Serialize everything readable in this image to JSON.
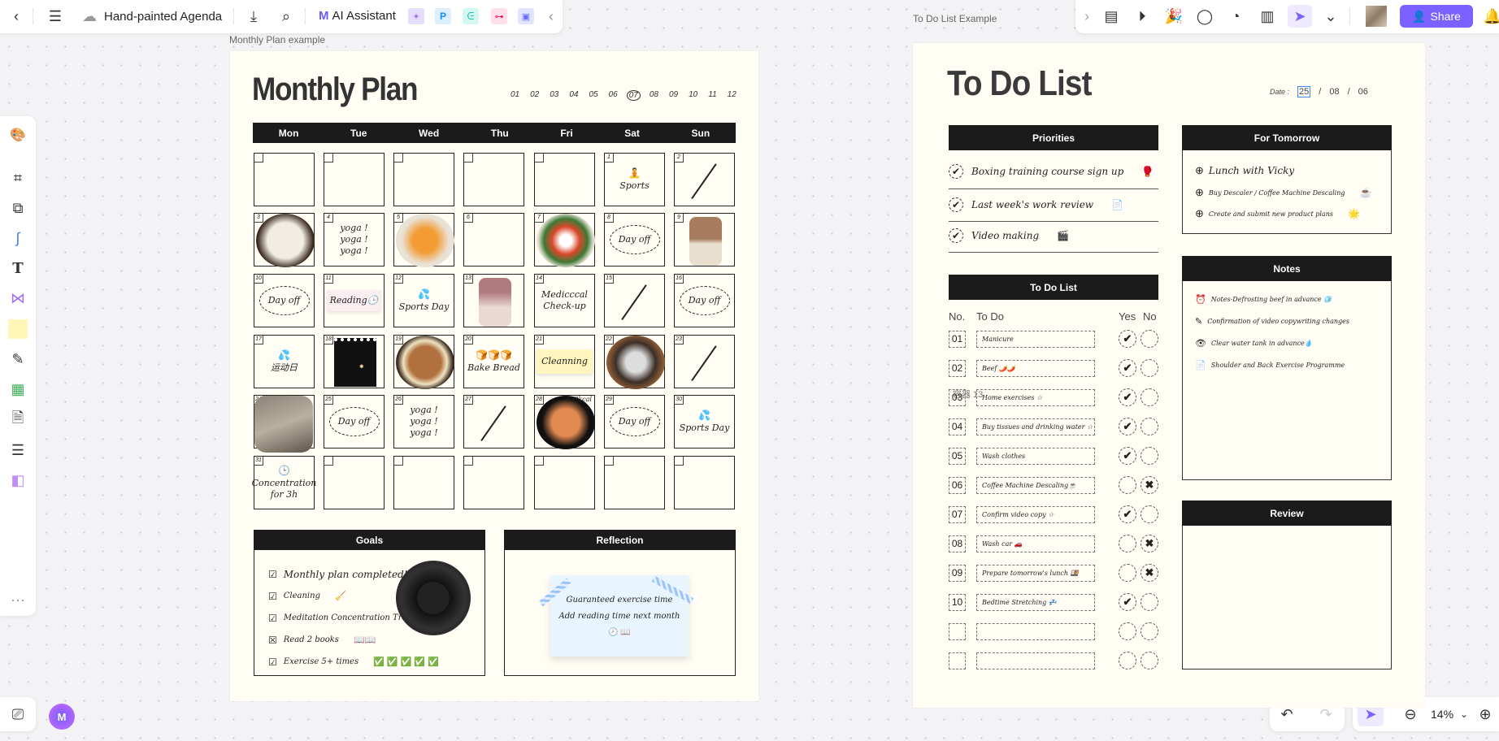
{
  "toolbar": {
    "title": "Hand-painted Agenda",
    "ai_label": "AI Assistant",
    "share_label": "Share",
    "zoom": "14%",
    "accent": "#7b61ff"
  },
  "frames": {
    "monthly_label": "Monthly Plan example",
    "todo_label": "To Do List Example",
    "container_label": "容器 13"
  },
  "monthly": {
    "title": "Monthly Plan",
    "months": [
      "01",
      "02",
      "03",
      "04",
      "05",
      "06",
      "07",
      "08",
      "09",
      "10",
      "11",
      "12"
    ],
    "selected_month": "07",
    "weekdays": [
      "Mon",
      "Tue",
      "Wed",
      "Thu",
      "Fri",
      "Sat",
      "Sun"
    ],
    "cells": [
      {
        "day": ""
      },
      {
        "day": ""
      },
      {
        "day": ""
      },
      {
        "day": ""
      },
      {
        "day": ""
      },
      {
        "day": "1",
        "kind": "text",
        "icon": "🧘",
        "text": "Sports"
      },
      {
        "day": "2",
        "kind": "slash"
      },
      {
        "day": "3",
        "kind": "photo",
        "photo": "rice-bowl-photo"
      },
      {
        "day": "4",
        "kind": "text",
        "text": "yoga !\n  yoga !\n    yoga !"
      },
      {
        "day": "5",
        "kind": "photo",
        "photo": "fruit-plate-photo"
      },
      {
        "day": "6"
      },
      {
        "day": "7",
        "kind": "photo",
        "photo": "salad-photo"
      },
      {
        "day": "8",
        "kind": "dayoff",
        "text": "Day off"
      },
      {
        "day": "9",
        "kind": "photo",
        "photo": "iced-coffee-photo"
      },
      {
        "day": "10",
        "kind": "dayoff",
        "text": "Day off"
      },
      {
        "day": "11",
        "kind": "sticker",
        "text": "Reading🕒"
      },
      {
        "day": "12",
        "kind": "text",
        "icon": "💦",
        "text": "Sports Day"
      },
      {
        "day": "13",
        "kind": "photo",
        "photo": "drink-cup-photo"
      },
      {
        "day": "14",
        "kind": "text",
        "text": "Medicccal\nCheck-up"
      },
      {
        "day": "15",
        "kind": "slash"
      },
      {
        "day": "16",
        "kind": "dayoff",
        "text": "Day off"
      },
      {
        "day": "17",
        "kind": "text",
        "icon": "💦",
        "text": "运动日"
      },
      {
        "day": "18",
        "kind": "photo",
        "photo": "film-moon-photo"
      },
      {
        "day": "19",
        "kind": "photo",
        "photo": "granola-bowl-photo"
      },
      {
        "day": "20",
        "kind": "text",
        "icon": "🍞🍞🍞",
        "text": "Bake Bread"
      },
      {
        "day": "21",
        "kind": "note",
        "text": "Cleanning"
      },
      {
        "day": "22",
        "kind": "photo",
        "photo": "pizza-photo"
      },
      {
        "day": "23",
        "kind": "slash"
      },
      {
        "day": "24",
        "kind": "photo",
        "photo": "cat-photo"
      },
      {
        "day": "25",
        "kind": "dayoff",
        "text": "Day off"
      },
      {
        "day": "26",
        "kind": "text",
        "text": "yoga !\n  yoga !\n    yoga !"
      },
      {
        "day": "27",
        "kind": "slash"
      },
      {
        "day": "28",
        "kind": "photo",
        "photo": "stone-bowl-photo",
        "text": "439kcal"
      },
      {
        "day": "29",
        "kind": "dayoff",
        "text": "Day off"
      },
      {
        "day": "30",
        "kind": "text",
        "icon": "💦",
        "text": "Sports Day"
      },
      {
        "day": "31",
        "kind": "text",
        "icon": "🕒",
        "text": "Concentration\nfor 3h"
      },
      {
        "day": ""
      },
      {
        "day": ""
      },
      {
        "day": ""
      },
      {
        "day": ""
      },
      {
        "day": ""
      },
      {
        "day": ""
      }
    ],
    "goals": {
      "title": "Goals",
      "items": [
        {
          "text": "Monthly plan completed!",
          "extra": ""
        },
        {
          "text": "Cleaning",
          "extra": "🧹"
        },
        {
          "text": "Meditation Concentration Training",
          "extra": "🕒"
        },
        {
          "text": "Read 2 books",
          "extra": "📖📖"
        },
        {
          "text": "Exercise 5+ times",
          "extra": "✅ ✅ ✅ ✅ ✅"
        }
      ]
    },
    "reflection": {
      "title": "Reflection",
      "lines": [
        "Guaranteed exercise time",
        "Add reading time next month",
        "🕗 📖"
      ]
    }
  },
  "todo": {
    "title": "To Do List",
    "date_label": "Date :",
    "date": [
      "25",
      "08",
      "06"
    ],
    "priorities": {
      "title": "Priorities",
      "items": [
        {
          "text": "Boxing training course sign up",
          "emoji": "🥊"
        },
        {
          "text": "Last week's work review",
          "emoji": "📄"
        },
        {
          "text": "Video making",
          "emoji": "🎬"
        }
      ]
    },
    "tomorrow": {
      "title": "For Tomorrow",
      "items": [
        {
          "text": "Lunch with Vicky",
          "emoji": ""
        },
        {
          "text": "Buy Descaler / Coffee Machine Descaling",
          "emoji": "☕"
        },
        {
          "text": "Create and submit new product plans",
          "emoji": "🌟"
        }
      ]
    },
    "notes": {
      "title": "Notes",
      "items": [
        {
          "icon": "⏰",
          "text": "Notes-Defrosting beef in advance 🧊"
        },
        {
          "icon": "✎",
          "text": "Confirmation of video copywriting changes"
        },
        {
          "icon": "👁",
          "text": "Clear water tank in advance💧"
        },
        {
          "icon": "📄",
          "text": "Shoulder and Back Exercise Programme"
        }
      ]
    },
    "review": {
      "title": "Review"
    },
    "list": {
      "title": "To Do List",
      "headers": {
        "no": "No.",
        "todo": "To Do",
        "yes": "Yes",
        "no_col": "No"
      },
      "rows": [
        {
          "no": "01",
          "text": "Manicure",
          "done": "yes"
        },
        {
          "no": "02",
          "text": "Beef  🌶️🌶️",
          "done": "yes"
        },
        {
          "no": "03",
          "text": "Home exercises ☆",
          "done": "yes"
        },
        {
          "no": "04",
          "text": "Buy tissues and drinking water ☆",
          "done": "yes"
        },
        {
          "no": "05",
          "text": "Wash clothes",
          "done": "yes"
        },
        {
          "no": "06",
          "text": "Coffee Machine Descaling☕",
          "done": "no"
        },
        {
          "no": "07",
          "text": "Confirm video copy    ☆",
          "done": "yes"
        },
        {
          "no": "08",
          "text": "Wash car 🚗",
          "done": "no"
        },
        {
          "no": "09",
          "text": "Prepare tomorrow's lunch 🍱",
          "done": "no"
        },
        {
          "no": "10",
          "text": "Bedtime Stretching 💤",
          "done": "yes"
        },
        {
          "no": "",
          "text": "",
          "done": ""
        },
        {
          "no": "",
          "text": "",
          "done": ""
        }
      ]
    }
  }
}
